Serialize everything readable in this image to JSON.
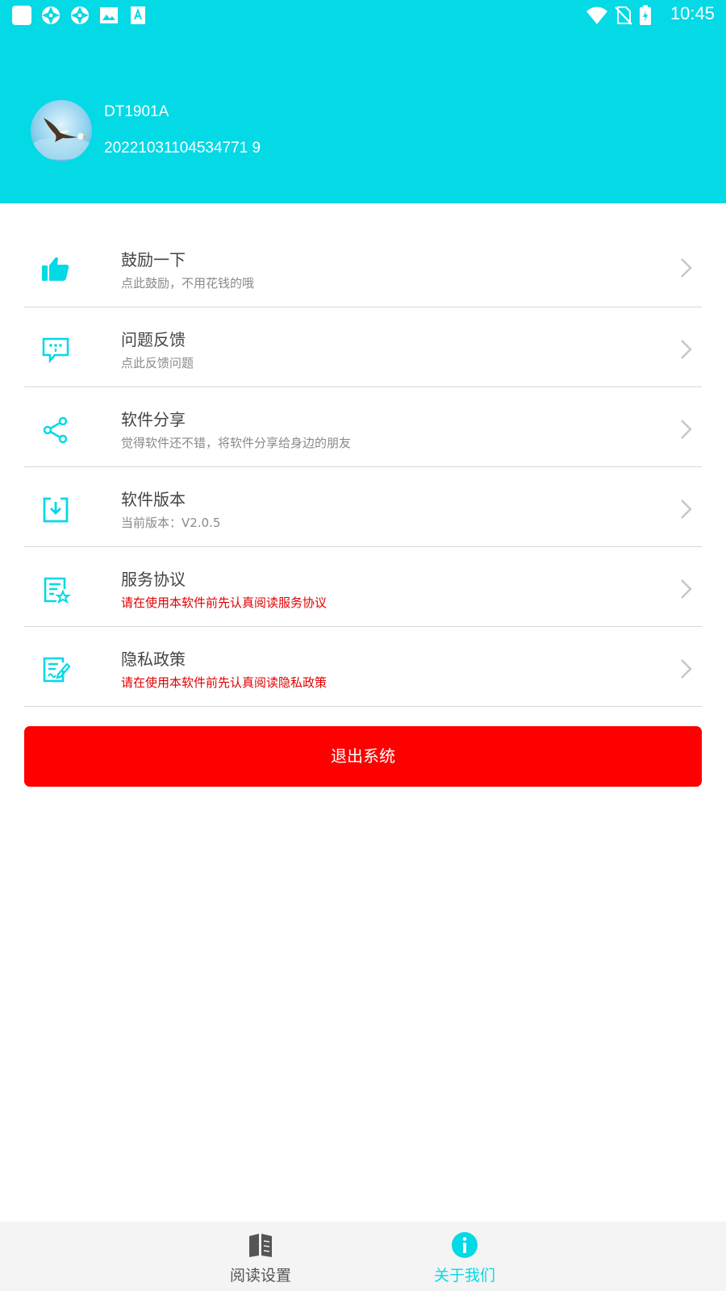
{
  "status_bar": {
    "time": "10:45",
    "left_icons": [
      "app-square-icon",
      "aperture-icon",
      "aperture-icon",
      "image-icon",
      "font-icon"
    ],
    "right_icons": [
      "wifi-icon",
      "no-sim-icon",
      "battery-charging-icon"
    ]
  },
  "profile": {
    "name": "DT1901A",
    "id": "20221031104534771 9"
  },
  "menu": {
    "items": [
      {
        "title": "鼓励一下",
        "subtitle": "点此鼓励，不用花钱的哦",
        "icon": "thumbs-up-icon"
      },
      {
        "title": "问题反馈",
        "subtitle": "点此反馈问题",
        "icon": "feedback-icon"
      },
      {
        "title": "软件分享",
        "subtitle": "觉得软件还不错，将软件分享给身边的朋友",
        "icon": "share-icon"
      },
      {
        "title": "软件版本",
        "subtitle": "当前版本：V2.0.5",
        "icon": "download-box-icon"
      },
      {
        "title": "服务协议",
        "subtitle": "请在使用本软件前先认真阅读服务协议",
        "icon": "agreement-icon"
      },
      {
        "title": "隐私政策",
        "subtitle": "请在使用本软件前先认真阅读隐私政策",
        "icon": "privacy-doc-icon"
      }
    ]
  },
  "logout_label": "退出系统",
  "bottom_nav": {
    "items": [
      {
        "label": "阅读设置",
        "icon": "book-icon",
        "active": false
      },
      {
        "label": "关于我们",
        "icon": "info-icon",
        "active": true
      }
    ]
  },
  "colors": {
    "accent": "#04d9e6",
    "warning_text": "#e10000",
    "logout": "#ff0000",
    "inactive_nav": "#555555"
  }
}
